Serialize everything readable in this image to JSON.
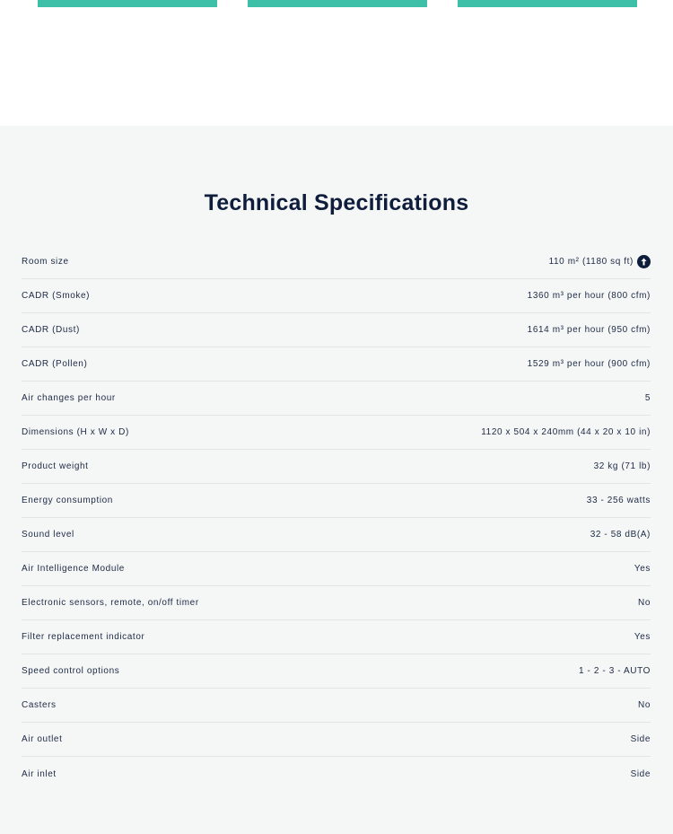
{
  "colors": {
    "accent_teal": "#3dbfa8",
    "heading_navy": "#0f1d3d",
    "section_background": "#f5f6f6"
  },
  "specs": {
    "title": "Technical Specifications",
    "info_icon": "info-circle-icon",
    "rows": [
      {
        "label": "Room size",
        "value": "110 m² (1180 sq ft)",
        "has_info_icon": true
      },
      {
        "label": "CADR (Smoke)",
        "value": "1360 m³ per hour (800 cfm)"
      },
      {
        "label": "CADR (Dust)",
        "value": "1614 m³ per hour (950 cfm)"
      },
      {
        "label": "CADR (Pollen)",
        "value": "1529 m³ per hour (900 cfm)"
      },
      {
        "label": "Air changes per hour",
        "value": "5"
      },
      {
        "label": "Dimensions (H x W x D)",
        "value": "1120 x 504 x 240mm (44 x 20 x 10 in)"
      },
      {
        "label": "Product weight",
        "value": "32 kg (71 lb)"
      },
      {
        "label": "Energy consumption",
        "value": "33 - 256 watts"
      },
      {
        "label": "Sound level",
        "value": "32 - 58 dB(A)"
      },
      {
        "label": "Air Intelligence Module",
        "value": "Yes"
      },
      {
        "label": "Electronic sensors, remote, on/off timer",
        "value": "No"
      },
      {
        "label": "Filter replacement indicator",
        "value": "Yes"
      },
      {
        "label": "Speed control options",
        "value": "1 - 2 - 3 - AUTO"
      },
      {
        "label": "Casters",
        "value": "No"
      },
      {
        "label": "Air outlet",
        "value": "Side"
      },
      {
        "label": "Air inlet",
        "value": "Side"
      }
    ]
  }
}
